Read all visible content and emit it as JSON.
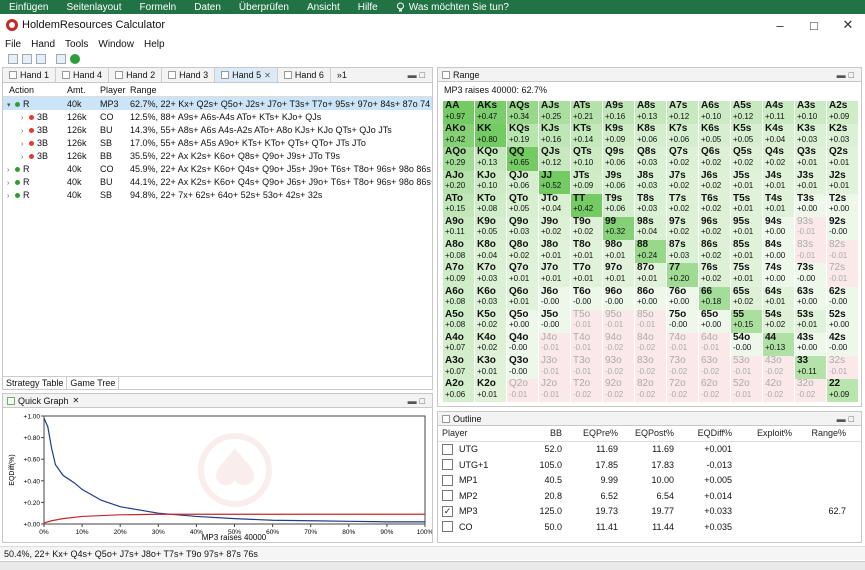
{
  "ribbon": [
    "Einfügen",
    "Seitenlayout",
    "Formeln",
    "Daten",
    "Überprüfen",
    "Ansicht",
    "Hilfe"
  ],
  "ribbon_tell": "Was möchten Sie tun?",
  "window_title": "HoldemResources Calculator",
  "menu": [
    "File",
    "Hand",
    "Tools",
    "Window",
    "Help"
  ],
  "hand_tabs": [
    "Hand 1",
    "Hand 4",
    "Hand 2",
    "Hand 3",
    "Hand 5",
    "Hand 6"
  ],
  "hand_tabs_overflow": "»1",
  "tree_columns": [
    "Action",
    "Amt.",
    "Player",
    "Range"
  ],
  "tree_rows": [
    {
      "action": "R",
      "amt": "40k",
      "player": "MP3",
      "range": "62.7%, 22+ Kx+ Q2s+ Q5o+ J2s+ J7o+ T3s+ T7o+ 95s+ 97o+ 84s+ 87o 74",
      "color": "#2e9d3a",
      "arrow": "▾",
      "indent": 0,
      "selected": true
    },
    {
      "action": "3B",
      "amt": "126k",
      "player": "CO",
      "range": "12.5%, 88+ A9s+ A6s-A4s ATo+ KTs+ KJo+ QJs",
      "color": "#e53935",
      "arrow": "›",
      "indent": 1
    },
    {
      "action": "3B",
      "amt": "126k",
      "player": "BU",
      "range": "14.3%, 55+ A8s+ A6s A4s-A2s ATo+ A8o KJs+ KJo QTs+ QJo JTs",
      "color": "#e53935",
      "arrow": "›",
      "indent": 1
    },
    {
      "action": "3B",
      "amt": "126k",
      "player": "SB",
      "range": "17.0%, 55+ A8s+ A5s A9o+ KTs+ KTo+ QTs+ QTo+ JTs JTo",
      "color": "#e53935",
      "arrow": "›",
      "indent": 1
    },
    {
      "action": "3B",
      "amt": "126k",
      "player": "BB",
      "range": "35.5%, 22+ Ax K2s+ K6o+ Q8s+ Q9o+ J9s+ JTo T9s",
      "color": "#e53935",
      "arrow": "›",
      "indent": 1
    },
    {
      "action": "R",
      "amt": "40k",
      "player": "CO",
      "range": "45.9%, 22+ Ax K2s+ K6o+ Q4s+ Q9o+ J5s+ J9o+ T6s+ T8o+ 96s+ 98o 86s",
      "color": "#2e9d3a",
      "arrow": "›",
      "indent": 0
    },
    {
      "action": "R",
      "amt": "40k",
      "player": "BU",
      "range": "44.1%, 22+ Ax K2s+ K6o+ Q4s+ Q9o+ J6s+ J9o+ T6s+ T8o+ 96s+ 98o 86s+",
      "color": "#2e9d3a",
      "arrow": "›",
      "indent": 0
    },
    {
      "action": "R",
      "amt": "40k",
      "player": "SB",
      "range": "94.8%, 22+ 7x+ 62s+ 64o+ 52s+ 53o+ 42s+ 32s",
      "color": "#2e9d3a",
      "arrow": "›",
      "indent": 0
    }
  ],
  "bottom_tabs": [
    "Strategy Table",
    "Game Tree"
  ],
  "quick_graph": {
    "tab": "Quick Graph",
    "ylabel": "EQDiff(%)",
    "xlabel": "MP3 raises 40000",
    "yticks": [
      "+1.00",
      "+0.80",
      "+0.60",
      "+0.40",
      "+0.20",
      "+0.00"
    ],
    "xticks": [
      "0%",
      "10%",
      "20%",
      "30%",
      "40%",
      "50%",
      "60%",
      "70%",
      "80%",
      "90%",
      "100%"
    ]
  },
  "chart_data": {
    "type": "line",
    "xlabel": "MP3 raises 40000",
    "ylabel": "EQDiff(%)",
    "xlim": [
      0,
      100
    ],
    "ylim": [
      0,
      1
    ],
    "grid": false,
    "series": [
      {
        "color": "#1f3b8c",
        "x": [
          0,
          1,
          2,
          3,
          5,
          8,
          10,
          15,
          20,
          30,
          40,
          50,
          60,
          70,
          80,
          90,
          100
        ],
        "y": [
          0.98,
          0.9,
          0.7,
          0.55,
          0.45,
          0.38,
          0.32,
          0.22,
          0.16,
          0.1,
          0.07,
          0.05,
          0.035,
          0.03,
          0.025,
          0.02,
          0.02
        ]
      },
      {
        "color": "#c62828",
        "x": [
          0,
          2,
          5,
          10,
          20,
          30,
          40,
          50,
          60,
          70,
          80,
          90,
          100
        ],
        "y": [
          0.01,
          0.03,
          0.05,
          0.07,
          0.085,
          0.09,
          0.09,
          0.09,
          0.09,
          0.09,
          0.09,
          0.09,
          0.09
        ]
      }
    ]
  },
  "range_panel": {
    "tab": "Range",
    "label": "MP3 raises 40000: 62.7%"
  },
  "range_grid": [
    [
      "AA|+0.97",
      "AKs|+0.47",
      "AQs|+0.34",
      "AJs|+0.25",
      "ATs|+0.21",
      "A9s|+0.16",
      "A8s|+0.13",
      "A7s|+0.12",
      "A6s|+0.10",
      "A5s|+0.12",
      "A4s|+0.11",
      "A3s|+0.10",
      "A2s|+0.09"
    ],
    [
      "AKo|+0.42",
      "KK|+0.80",
      "KQs|+0.19",
      "KJs|+0.16",
      "KTs|+0.14",
      "K9s|+0.09",
      "K8s|+0.06",
      "K7s|+0.06",
      "K6s|+0.05",
      "K5s|+0.05",
      "K4s|+0.04",
      "K3s|+0.03",
      "K2s|+0.03"
    ],
    [
      "AQo|+0.29",
      "KQo|+0.13",
      "QQ|+0.65",
      "QJs|+0.12",
      "QTs|+0.10",
      "Q9s|+0.06",
      "Q8s|+0.03",
      "Q7s|+0.02",
      "Q6s|+0.02",
      "Q5s|+0.02",
      "Q4s|+0.02",
      "Q3s|+0.01",
      "Q2s|+0.01"
    ],
    [
      "AJo|+0.20",
      "KJo|+0.10",
      "QJo|+0.06",
      "JJ|+0.52",
      "JTs|+0.09",
      "J9s|+0.06",
      "J8s|+0.03",
      "J7s|+0.02",
      "J6s|+0.02",
      "J5s|+0.01",
      "J4s|+0.01",
      "J3s|+0.01",
      "J2s|+0.01"
    ],
    [
      "ATo|+0.15",
      "KTo|+0.08",
      "QTo|+0.05",
      "JTo|+0.04",
      "TT|+0.42",
      "T9s|+0.06",
      "T8s|+0.03",
      "T7s|+0.02",
      "T6s|+0.02",
      "T5s|+0.01",
      "T4s|+0.01",
      "T3s|+0.00",
      "T2s|+0.00"
    ],
    [
      "A9o|+0.11",
      "K9o|+0.05",
      "Q9o|+0.03",
      "J9o|+0.02",
      "T9o|+0.02",
      "99|+0.32",
      "98s|+0.04",
      "97s|+0.02",
      "96s|+0.02",
      "95s|+0.01",
      "94s|+0.00",
      "93s|-0.01",
      "92s|-0.00"
    ],
    [
      "A8o|+0.08",
      "K8o|+0.04",
      "Q8o|+0.02",
      "J8o|+0.01",
      "T8o|+0.01",
      "98o|+0.01",
      "88|+0.24",
      "87s|+0.03",
      "86s|+0.02",
      "85s|+0.01",
      "84s|+0.00",
      "83s|-0.01",
      "82s|-0.01"
    ],
    [
      "A7o|+0.09",
      "K7o|+0.03",
      "Q7o|+0.01",
      "J7o|+0.01",
      "T7o|+0.01",
      "97o|+0.01",
      "87o|+0.01",
      "77|+0.20",
      "76s|+0.02",
      "75s|+0.01",
      "74s|+0.00",
      "73s|-0.00",
      "72s|-0.01"
    ],
    [
      "A6o|+0.08",
      "K6o|+0.03",
      "Q6o|+0.01",
      "J6o|-0.00",
      "T6o|-0.00",
      "96o|-0.00",
      "86o|+0.00",
      "76o|+0.00",
      "66|+0.18",
      "65s|+0.02",
      "64s|+0.01",
      "63s|+0.00",
      "62s|-0.00"
    ],
    [
      "A5o|+0.08",
      "K5o|+0.02",
      "Q5o|+0.00",
      "J5o|-0.00",
      "T5o|-0.01",
      "95o|-0.01",
      "85o|-0.01",
      "75o|-0.00",
      "65o|+0.00",
      "55|+0.15",
      "54s|+0.02",
      "53s|+0.01",
      "52s|+0.00"
    ],
    [
      "A4o|+0.07",
      "K4o|+0.02",
      "Q4o|-0.00",
      "J4o|-0.01",
      "T4o|-0.01",
      "94o|-0.02",
      "84o|-0.02",
      "74o|-0.01",
      "64o|-0.01",
      "54o|-0.00",
      "44|+0.13",
      "43s|+0.00",
      "42s|-0.00"
    ],
    [
      "A3o|+0.07",
      "K3o|+0.01",
      "Q3o|-0.00",
      "J3o|-0.01",
      "T3o|-0.01",
      "93o|-0.02",
      "83o|-0.02",
      "73o|-0.02",
      "63o|-0.02",
      "53o|-0.01",
      "43o|-0.02",
      "33|+0.11",
      "32s|-0.01"
    ],
    [
      "A2o|+0.06",
      "K2o|+0.01",
      "Q2o|-0.01",
      "J2o|-0.01",
      "T2o|-0.02",
      "92o|-0.02",
      "82o|-0.02",
      "72o|-0.02",
      "62o|-0.02",
      "52o|-0.01",
      "42o|-0.02",
      "32o|-0.02",
      "22|+0.09"
    ]
  ],
  "outline": {
    "tab": "Outline",
    "columns": [
      "Player",
      "BB",
      "EQPre%",
      "EQPost%",
      "EQDiff%",
      "Exploit%",
      "Range%"
    ],
    "rows": [
      {
        "player": "UTG",
        "bb": "52.0",
        "pre": "11.69",
        "post": "11.69",
        "diff": "+0.001",
        "exploit": "",
        "range": "",
        "checked": false
      },
      {
        "player": "UTG+1",
        "bb": "105.0",
        "pre": "17.85",
        "post": "17.83",
        "diff": "-0.013",
        "exploit": "",
        "range": "",
        "checked": false
      },
      {
        "player": "MP1",
        "bb": "40.5",
        "pre": "9.99",
        "post": "10.00",
        "diff": "+0.005",
        "exploit": "",
        "range": "",
        "checked": false
      },
      {
        "player": "MP2",
        "bb": "20.8",
        "pre": "6.52",
        "post": "6.54",
        "diff": "+0.014",
        "exploit": "",
        "range": "",
        "checked": false
      },
      {
        "player": "MP3",
        "bb": "125.0",
        "pre": "19.73",
        "post": "19.77",
        "diff": "+0.033",
        "exploit": "",
        "range": "62.7",
        "checked": true
      },
      {
        "player": "CO",
        "bb": "50.0",
        "pre": "11.41",
        "post": "11.44",
        "diff": "+0.035",
        "exploit": "",
        "range": "",
        "checked": false
      }
    ]
  },
  "status_text": "50.4%, 22+ Kx+ Q4s+ Q5o+ J7s+ J8o+ T7s+ T9o 97s+ 87s 76s",
  "colors": {
    "ribbon": "#217346",
    "accent": "#2e9d3a",
    "selected": "#cce4f7"
  }
}
